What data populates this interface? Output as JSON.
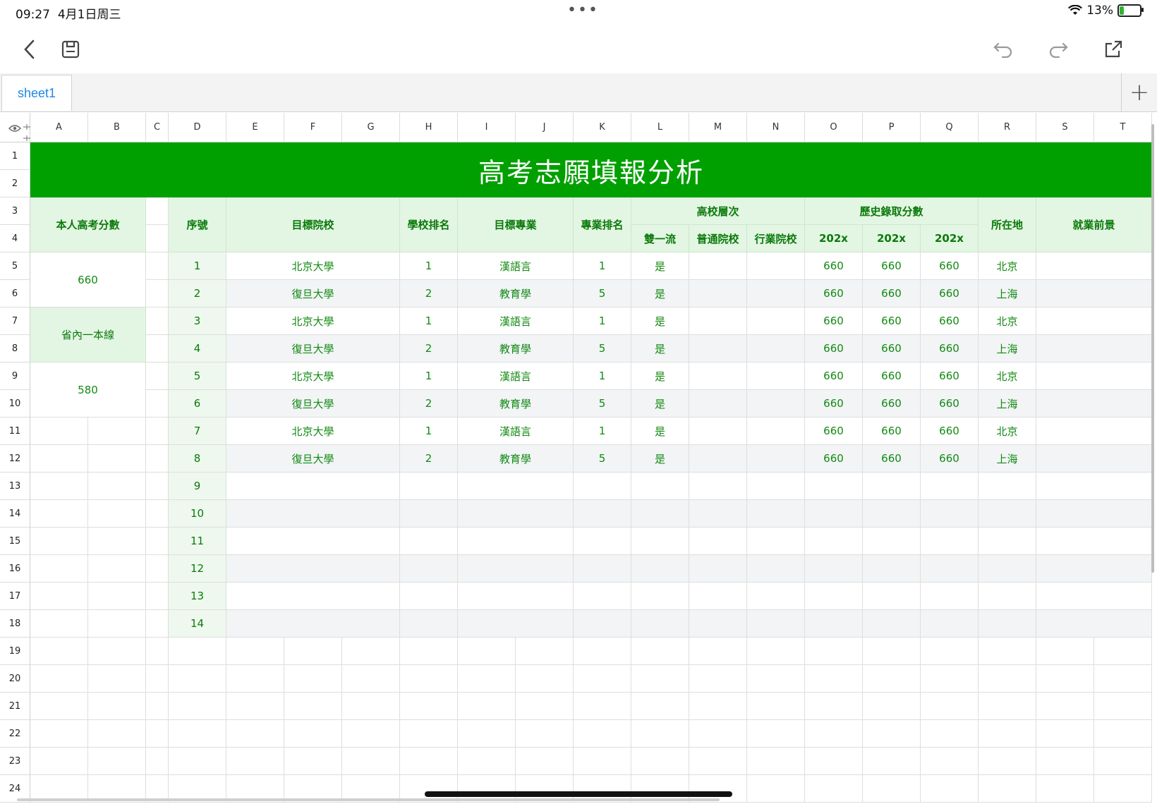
{
  "status": {
    "time": "09:27",
    "date": "4月1日周三",
    "battery": "13%"
  },
  "toolbar": {
    "back_icon": "chevron-left-icon",
    "save_icon": "save-icon",
    "undo_icon": "undo-icon",
    "redo_icon": "redo-icon",
    "share_icon": "share-icon"
  },
  "tabs": {
    "active": "sheet1",
    "add_label": "+"
  },
  "columns": [
    "A",
    "B",
    "C",
    "D",
    "E",
    "F",
    "G",
    "H",
    "I",
    "J",
    "K",
    "L",
    "M",
    "N",
    "O",
    "P",
    "Q",
    "R",
    "S",
    "T"
  ],
  "rows": [
    "1",
    "2",
    "3",
    "4",
    "5",
    "6",
    "7",
    "8",
    "9",
    "10",
    "11",
    "12",
    "13",
    "14",
    "15",
    "16",
    "17",
    "18",
    "19",
    "20",
    "21",
    "22",
    "23",
    "24"
  ],
  "sheet": {
    "title": "高考志願填報分析",
    "headers": {
      "score": "本人高考分數",
      "seq": "序號",
      "school": "目標院校",
      "school_rank": "學校排名",
      "major": "目標專業",
      "major_rank": "專業排名",
      "tier": "高校層次",
      "tier_1": "雙一流",
      "tier_2": "普通院校",
      "tier_3": "行業院校",
      "history": "歷史錄取分數",
      "h1": "202x",
      "h2": "202x",
      "h3": "202x",
      "location": "所在地",
      "prospect": "就業前景"
    },
    "left": {
      "score_value": "660",
      "line_label": "省內一本線",
      "line_value": "580"
    },
    "records": [
      [
        "1",
        "北京大學",
        "1",
        "漢語言",
        "1",
        "是",
        "",
        "",
        "660",
        "660",
        "660",
        "北京",
        ""
      ],
      [
        "2",
        "復旦大學",
        "2",
        "教育學",
        "5",
        "是",
        "",
        "",
        "660",
        "660",
        "660",
        "上海",
        ""
      ],
      [
        "3",
        "北京大學",
        "1",
        "漢語言",
        "1",
        "是",
        "",
        "",
        "660",
        "660",
        "660",
        "北京",
        ""
      ],
      [
        "4",
        "復旦大學",
        "2",
        "教育學",
        "5",
        "是",
        "",
        "",
        "660",
        "660",
        "660",
        "上海",
        ""
      ],
      [
        "5",
        "北京大學",
        "1",
        "漢語言",
        "1",
        "是",
        "",
        "",
        "660",
        "660",
        "660",
        "北京",
        ""
      ],
      [
        "6",
        "復旦大學",
        "2",
        "教育學",
        "5",
        "是",
        "",
        "",
        "660",
        "660",
        "660",
        "上海",
        ""
      ],
      [
        "7",
        "北京大學",
        "1",
        "漢語言",
        "1",
        "是",
        "",
        "",
        "660",
        "660",
        "660",
        "北京",
        ""
      ],
      [
        "8",
        "復旦大學",
        "2",
        "教育學",
        "5",
        "是",
        "",
        "",
        "660",
        "660",
        "660",
        "上海",
        ""
      ],
      [
        "9",
        "",
        "",
        "",
        "",
        "",
        "",
        "",
        "",
        "",
        "",
        "",
        ""
      ],
      [
        "10",
        "",
        "",
        "",
        "",
        "",
        "",
        "",
        "",
        "",
        "",
        "",
        ""
      ],
      [
        "11",
        "",
        "",
        "",
        "",
        "",
        "",
        "",
        "",
        "",
        "",
        "",
        ""
      ],
      [
        "12",
        "",
        "",
        "",
        "",
        "",
        "",
        "",
        "",
        "",
        "",
        "",
        ""
      ],
      [
        "13",
        "",
        "",
        "",
        "",
        "",
        "",
        "",
        "",
        "",
        "",
        "",
        ""
      ],
      [
        "14",
        "",
        "",
        "",
        "",
        "",
        "",
        "",
        "",
        "",
        "",
        "",
        ""
      ]
    ]
  }
}
